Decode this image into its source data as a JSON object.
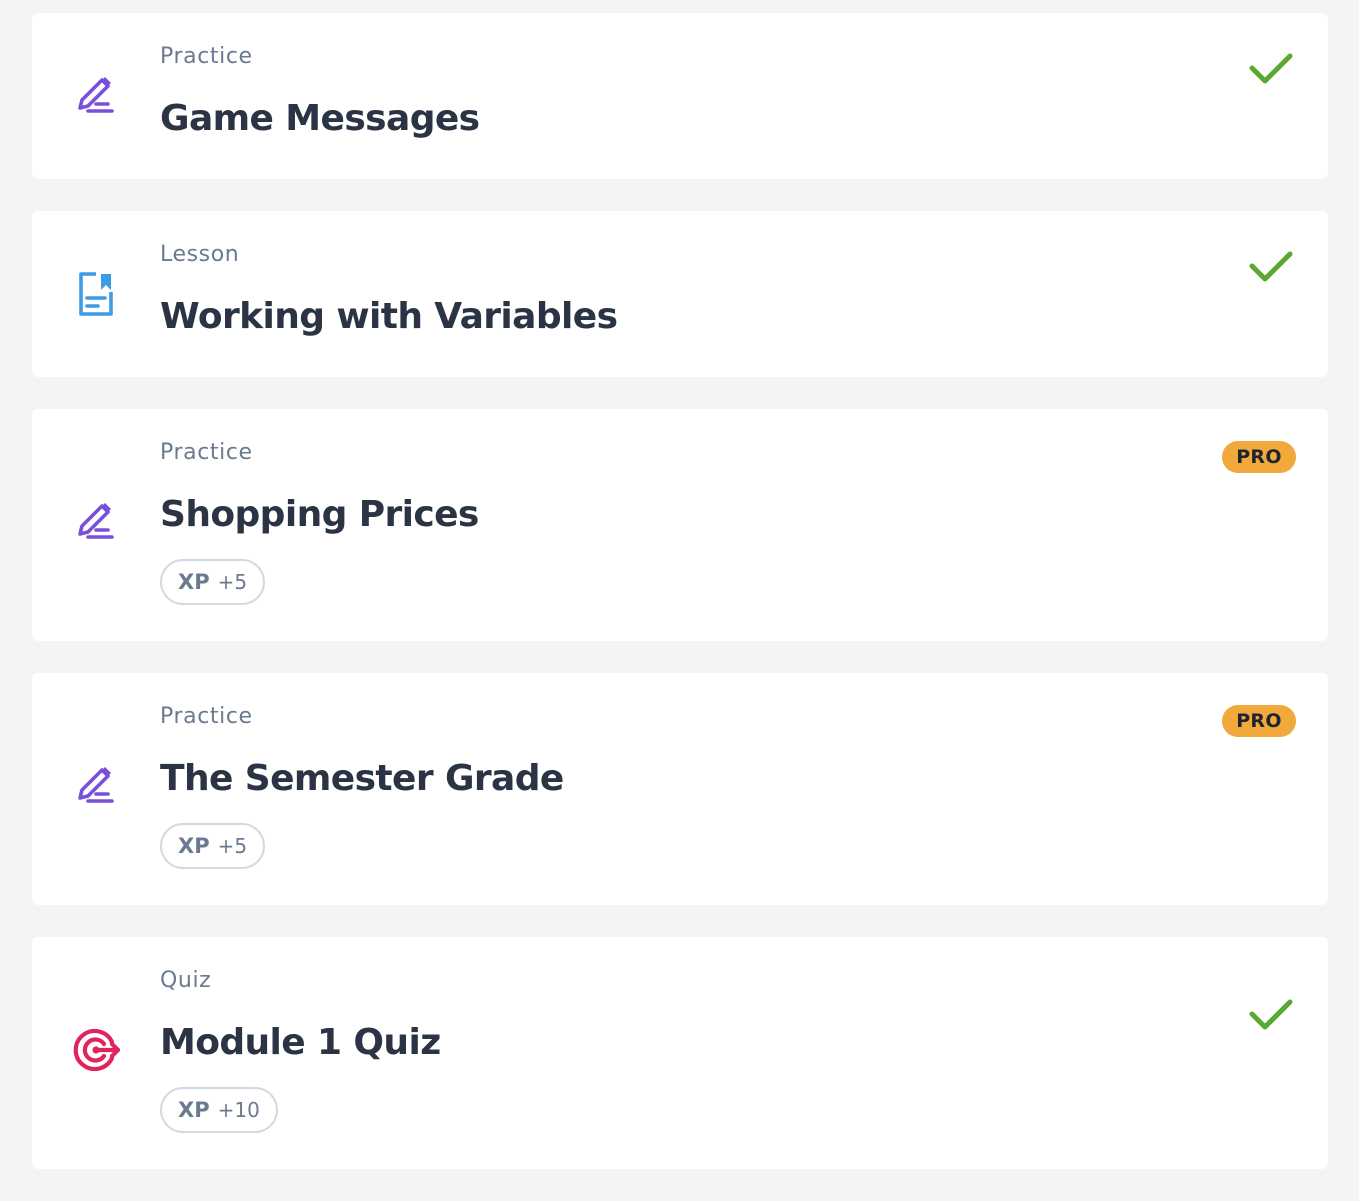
{
  "colors": {
    "practice": "#7a4fdb",
    "lesson": "#3d9ce6",
    "quiz": "#e0245e",
    "check": "#5aa832",
    "pro": "#f2a93b"
  },
  "items": [
    {
      "kind": "Practice",
      "icon": "pencil-icon",
      "title": "Game Messages",
      "completed": true
    },
    {
      "kind": "Lesson",
      "icon": "document-icon",
      "title": "Working with Variables",
      "completed": true
    },
    {
      "kind": "Practice",
      "icon": "pencil-icon",
      "title": "Shopping Prices",
      "badge": "PRO",
      "xp_label": "XP",
      "xp_value": "+5"
    },
    {
      "kind": "Practice",
      "icon": "pencil-icon",
      "title": "The Semester Grade",
      "badge": "PRO",
      "xp_label": "XP",
      "xp_value": "+5"
    },
    {
      "kind": "Quiz",
      "icon": "target-icon",
      "title": "Module 1 Quiz",
      "completed": true,
      "xp_label": "XP",
      "xp_value": "+10"
    }
  ]
}
